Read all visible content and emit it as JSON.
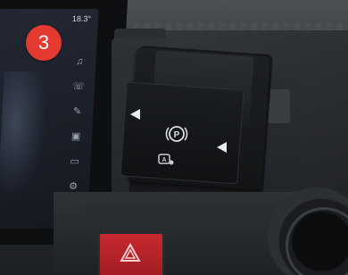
{
  "step": {
    "number": "3"
  },
  "screen": {
    "status_text": "18.3°",
    "side_icons": [
      "music-icon",
      "phone-icon",
      "wrench-icon",
      "bus-icon",
      "truck-icon",
      "settings-icon"
    ]
  },
  "switch": {
    "park_symbol": "(P)",
    "auto_label": "A"
  },
  "colors": {
    "badge": "#e53a32",
    "hazard": "#c8292f",
    "arrow": "#e8ecef"
  }
}
